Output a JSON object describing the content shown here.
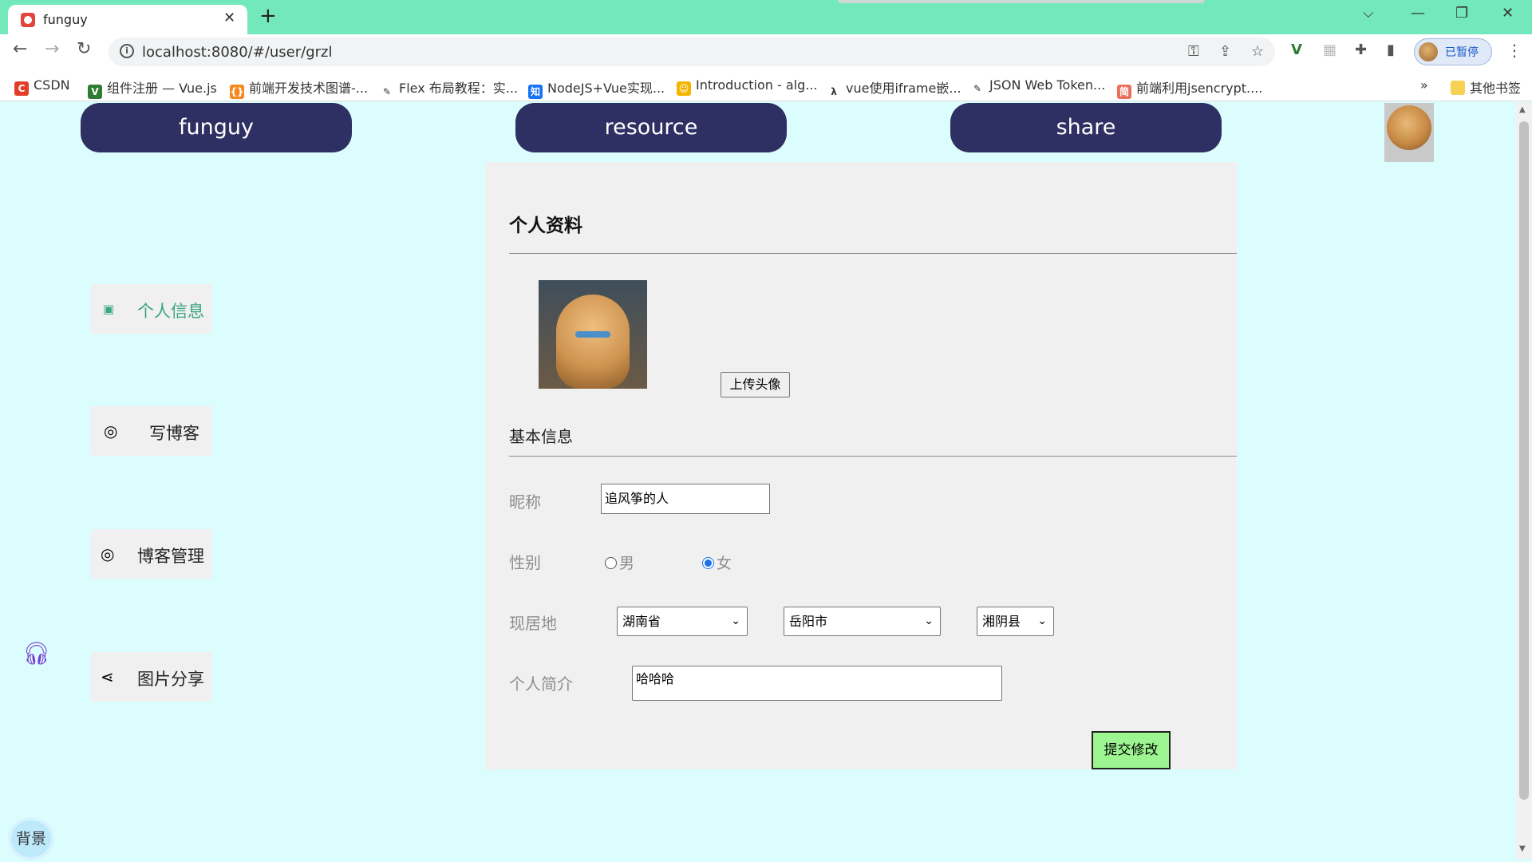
{
  "browser": {
    "tab_title": "funguy",
    "tab_close": "✕",
    "new_tab": "+",
    "url": "localhost:8080/#/user/grzl",
    "profile_status": "已暂停",
    "win_controls": {
      "dropdown": "⌵",
      "minimize": "—",
      "restore": "❐",
      "close": "✕"
    },
    "bookmarks": [
      {
        "label": "CSDN",
        "icon": "csdn-icon",
        "color": "#e33e2b"
      },
      {
        "label": "组件注册 — Vue.js",
        "icon": "vue-icon",
        "color": "#2e7d32"
      },
      {
        "label": "前端开发技术图谱-...",
        "icon": "code-bracket-icon",
        "color": "#f48a1f"
      },
      {
        "label": "Flex 布局教程：实...",
        "icon": "feather-icon",
        "color": "#333333"
      },
      {
        "label": "NodeJS+Vue实现...",
        "icon": "zhihu-icon",
        "color": "#1772f6"
      },
      {
        "label": "Introduction - alg...",
        "icon": "emoji-icon",
        "color": "#f4b400"
      },
      {
        "label": "vue使用iframe嵌...",
        "icon": "lambda-icon",
        "color": "#333333"
      },
      {
        "label": "JSON Web Token...",
        "icon": "feather-icon",
        "color": "#333333"
      },
      {
        "label": "前端利用jsencrypt....",
        "icon": "jianshu-icon",
        "color": "#ea6f5a"
      }
    ],
    "more_bookmarks": "»",
    "other_bookmarks": "其他书签"
  },
  "nav": {
    "items": [
      "funguy",
      "resource",
      "share"
    ],
    "color": "#2e2f62"
  },
  "sidebar": {
    "items": [
      {
        "label": "个人信息",
        "icon": "user-card-icon",
        "active": true
      },
      {
        "label": "写博客",
        "icon": "swirl-icon",
        "active": false
      },
      {
        "label": "博客管理",
        "icon": "swirl-icon",
        "active": false
      },
      {
        "label": "图片分享",
        "icon": "share-nodes-icon",
        "active": false
      }
    ],
    "active_color": "#3aa67e",
    "bg_button": "背景",
    "headset_icon": "headset-icon"
  },
  "profile": {
    "title": "个人资料",
    "upload_button": "上传头像",
    "basic_info_title": "基本信息",
    "nickname_label": "昵称",
    "nickname_value": "追风筝的人",
    "gender_label": "性别",
    "gender_options": [
      "男",
      "女"
    ],
    "gender_selected": "女",
    "location_label": "现居地",
    "province": "湖南省",
    "city": "岳阳市",
    "county": "湘阴县",
    "bio_label": "个人简介",
    "bio_value": "哈哈哈",
    "submit_button": "提交修改",
    "submit_color": "#9cf591"
  }
}
